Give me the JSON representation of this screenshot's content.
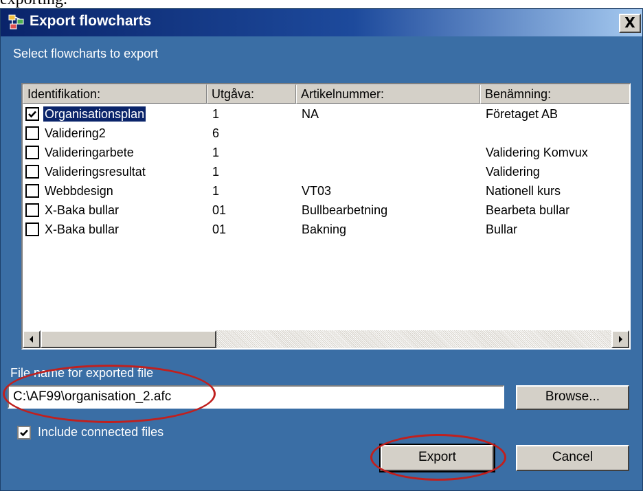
{
  "above_text": "exporting.",
  "window": {
    "title": "Export flowcharts",
    "close_label": "X"
  },
  "select_label": "Select flowcharts to export",
  "list": {
    "columns": [
      "Identifikation:",
      "Utgåva:",
      "Artikelnummer:",
      "Benämning:"
    ],
    "rows": [
      {
        "checked": true,
        "selected": true,
        "id": "Organisationsplan",
        "utgava": "1",
        "artikel": "NA",
        "benamning": "Företaget AB"
      },
      {
        "checked": false,
        "selected": false,
        "id": "Validering2",
        "utgava": "6",
        "artikel": "",
        "benamning": ""
      },
      {
        "checked": false,
        "selected": false,
        "id": "Valideringarbete",
        "utgava": "1",
        "artikel": "",
        "benamning": "Validering Komvux"
      },
      {
        "checked": false,
        "selected": false,
        "id": "Valideringsresultat",
        "utgava": "1",
        "artikel": "",
        "benamning": "Validering"
      },
      {
        "checked": false,
        "selected": false,
        "id": "Webbdesign",
        "utgava": "1",
        "artikel": "VT03",
        "benamning": "Nationell kurs"
      },
      {
        "checked": false,
        "selected": false,
        "id": "X-Baka bullar",
        "utgava": "01",
        "artikel": "Bullbearbetning",
        "benamning": "Bearbeta bullar"
      },
      {
        "checked": false,
        "selected": false,
        "id": "X-Baka bullar",
        "utgava": "01",
        "artikel": "Bakning",
        "benamning": "Bullar"
      }
    ]
  },
  "file": {
    "label": "File name for exported file",
    "value": "C:\\AF99\\organisation_2.afc"
  },
  "include": {
    "label": "Include connected files",
    "checked": true
  },
  "buttons": {
    "browse": "Browse...",
    "export": "Export",
    "cancel": "Cancel"
  },
  "colors": {
    "dialog_bg": "#3a6ea5",
    "annotation": "#c0201e"
  }
}
